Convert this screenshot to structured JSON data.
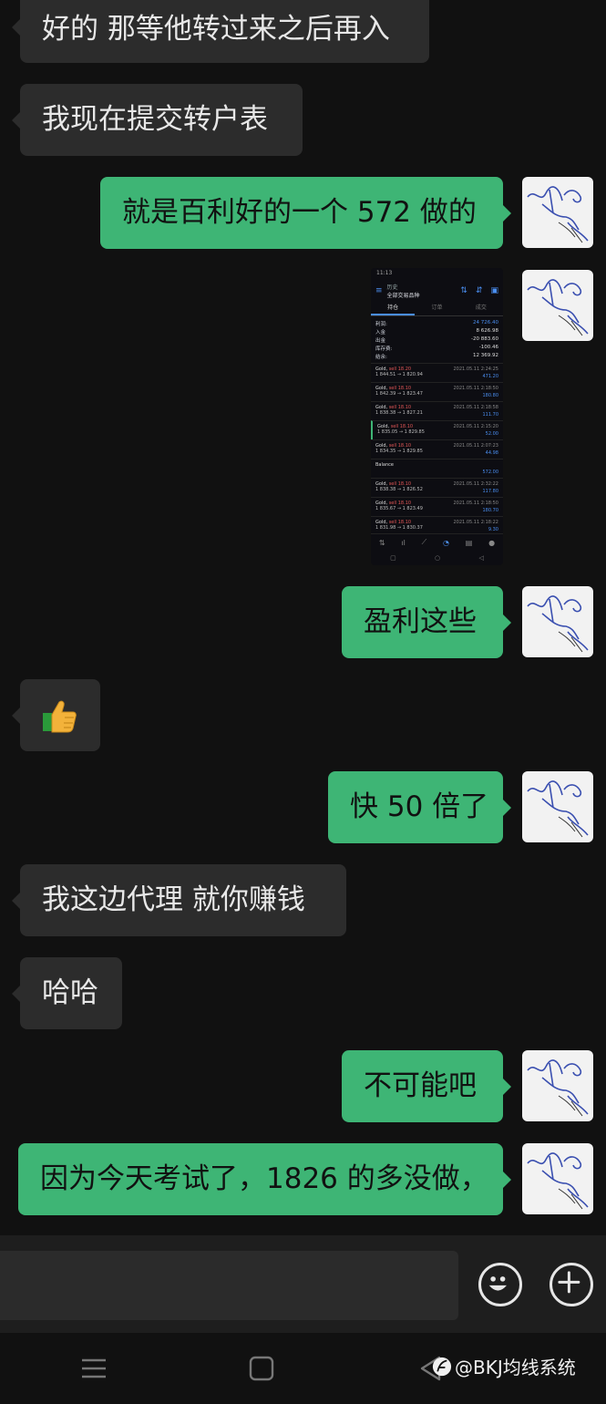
{
  "messages": [
    {
      "side": "in",
      "text": "好的 那等他转过来之后再入"
    },
    {
      "side": "in",
      "text": "我现在提交转户表"
    },
    {
      "side": "out",
      "text": "就是百利好的一个 572 做的"
    },
    {
      "side": "out",
      "type": "image",
      "text": ""
    },
    {
      "side": "out",
      "text": "盈利这些"
    },
    {
      "side": "in",
      "type": "emoji",
      "text": "👍"
    },
    {
      "side": "out",
      "text": "快 50 倍了"
    },
    {
      "side": "in",
      "text": "我这边代理 就你赚钱"
    },
    {
      "side": "in",
      "text": "哈哈"
    },
    {
      "side": "out",
      "text": "不可能吧"
    },
    {
      "side": "out",
      "text": "因为今天考试了，1826 的多没做，"
    }
  ],
  "screenshot": {
    "status_time": "11:13",
    "header_title_1": "历史",
    "header_title_2": "全部交易品种",
    "tabs": [
      "持仓",
      "订单",
      "成交"
    ],
    "summary": [
      {
        "label": "利润:",
        "value": "24 726.40"
      },
      {
        "label": "入金",
        "value": "8 626.98"
      },
      {
        "label": "出金",
        "value": "-20 883.60"
      },
      {
        "label": "库存费:",
        "value": "-100.46"
      },
      {
        "label": "结余:",
        "value": "12 369.92"
      }
    ],
    "deals": [
      {
        "symbol": "Gold,",
        "side": "sell 18.20",
        "prices": "1 844.51 → 1 820.94",
        "date": "2021.05.11 2:24:25",
        "profit": "471.20"
      },
      {
        "symbol": "Gold,",
        "side": "sell 18.10",
        "prices": "1 842.39 → 1 823.47",
        "date": "2021.05.11 2:18:50",
        "profit": "180.80"
      },
      {
        "symbol": "Gold,",
        "side": "sell 18.10",
        "prices": "1 838.38 → 1 827.21",
        "date": "2021.05.11 2:18:58",
        "profit": "111.70"
      },
      {
        "symbol": "Gold,",
        "side": "sell 18.10",
        "prices": "1 835.05 → 1 829.85",
        "date": "2021.05.11 2:15:20",
        "profit": "52.00"
      },
      {
        "symbol": "Gold,",
        "side": "sell 18.10",
        "prices": "1 834.35 → 1 829.85",
        "date": "2021.05.11 2:07:23",
        "profit": "44.98"
      },
      {
        "symbol": "Balance",
        "side": "",
        "prices": "",
        "date": "",
        "profit": "572.00"
      },
      {
        "symbol": "Gold,",
        "side": "sell 18.10",
        "prices": "1 838.38 → 1 826.52",
        "date": "2021.05.11 2:32:22",
        "profit": "117.80"
      },
      {
        "symbol": "Gold,",
        "side": "sell 18.10",
        "prices": "1 835.67 → 1 823.49",
        "date": "2021.05.11 2:18:50",
        "profit": "180.70"
      },
      {
        "symbol": "Gold,",
        "side": "sell 18.10",
        "prices": "1 831.98 → 1 830.37",
        "date": "2021.05.11 2:18:22",
        "profit": "9.30"
      }
    ]
  },
  "input": {
    "placeholder": ""
  },
  "watermark": {
    "text": "@BKJ均线系统"
  },
  "colors": {
    "background": "#111111",
    "incoming_bubble": "#2c2c2c",
    "outgoing_bubble": "#3eb575"
  },
  "icons": {
    "emoji_button": "smiley-icon",
    "plus_button": "plus-icon",
    "thumb": "thumbs-up-icon"
  }
}
